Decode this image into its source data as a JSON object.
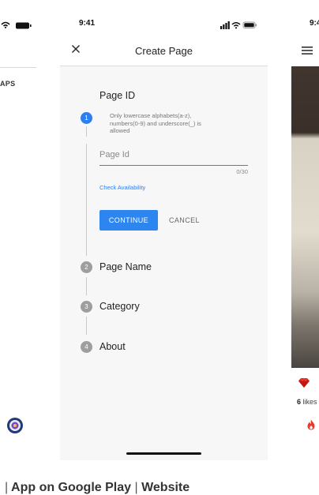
{
  "status_bar": {
    "time": "9:41"
  },
  "left_screen": {
    "tab_label": "APS"
  },
  "create_page": {
    "title": "Create Page",
    "steps": [
      {
        "number": "1",
        "label": "Page ID"
      },
      {
        "number": "2",
        "label": "Page Name"
      },
      {
        "number": "3",
        "label": "Category"
      },
      {
        "number": "4",
        "label": "About"
      }
    ],
    "page_id": {
      "hint": "Only lowercase alphabets(a-z), numbers(0-9) and underscore(_) is allowed",
      "placeholder": "Page Id",
      "value": "",
      "counter": "0/30",
      "check_link": "Check Availability",
      "continue_label": "CONTINUE",
      "cancel_label": "CANCEL"
    }
  },
  "right_screen": {
    "time": "9:4",
    "likes_count": "6",
    "likes_label": "likes"
  },
  "caption": {
    "separator": "|",
    "links": [
      "App on Google Play",
      "Website"
    ]
  },
  "colors": {
    "accent": "#2d85f0",
    "inactive_step": "#9e9e9e",
    "fire": "#e8392b"
  }
}
